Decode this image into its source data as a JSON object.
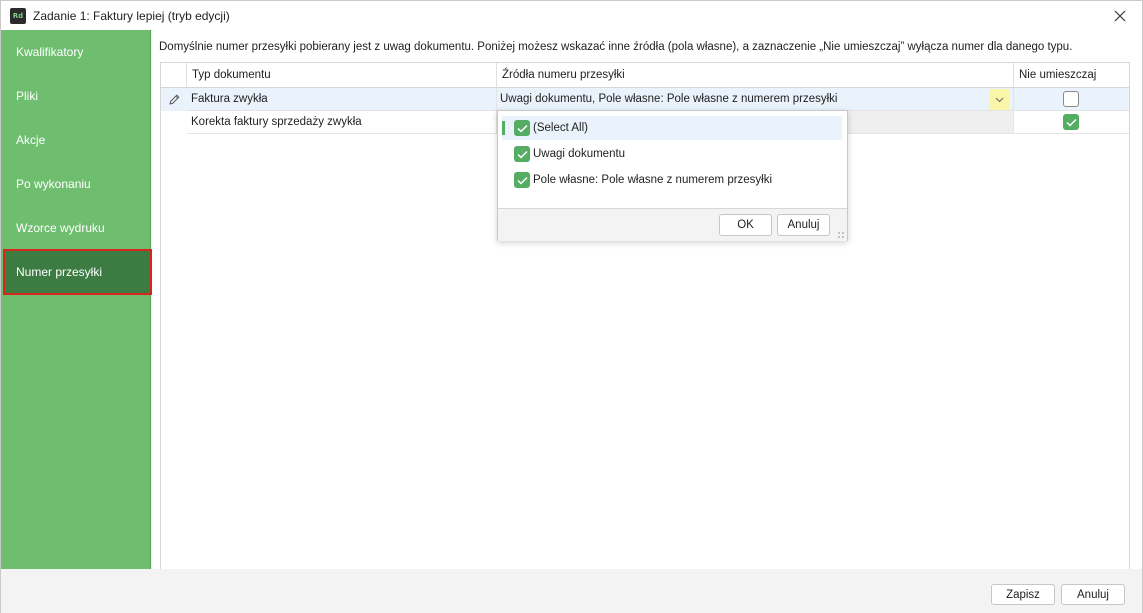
{
  "window": {
    "app_icon_text": "Rd",
    "title": "Zadanie 1: Faktury lepiej (tryb edycji)"
  },
  "sidebar": {
    "items": [
      {
        "label": "Kwalifikatory"
      },
      {
        "label": "Pliki"
      },
      {
        "label": "Akcje"
      },
      {
        "label": "Po wykonaniu"
      },
      {
        "label": "Wzorce wydruku"
      },
      {
        "label": "Numer przesyłki",
        "active": true
      }
    ]
  },
  "main": {
    "hint": "Domyślnie numer przesyłki pobierany jest z uwag dokumentu. Poniżej możesz wskazać inne źródła (pola własne), a zaznaczenie „Nie umieszczaj” wyłącza numer dla danego typu.",
    "grid": {
      "columns": [
        "Typ dokumentu",
        "Źródła numeru przesyłki",
        "Nie umieszczaj"
      ],
      "rows": [
        {
          "typ": "Faktura zwykła",
          "zrodla": "Uwagi dokumentu, Pole własne: Pole własne z numerem przesyłki",
          "nie_umieszczaj": false,
          "editing": true
        },
        {
          "typ": "Korekta faktury sprzedaży zwykła",
          "zrodla": "",
          "nie_umieszczaj": true,
          "editing": false
        }
      ]
    }
  },
  "dropdown": {
    "items": [
      {
        "label": "(Select All)",
        "checked": true,
        "focused": true
      },
      {
        "label": "Uwagi dokumentu",
        "checked": true
      },
      {
        "label": "Pole własne: Pole własne z numerem przesyłki",
        "checked": true
      }
    ],
    "ok_label": "OK",
    "cancel_label": "Anuluj"
  },
  "footer": {
    "save_label": "Zapisz",
    "cancel_label": "Anuluj"
  },
  "colors": {
    "sidebar_bg": "#6fbe70",
    "sidebar_active": "#3c7c43",
    "highlight_outline": "#d9261c",
    "checkbox_on": "#55ac63",
    "selected_row": "#eaf3fb",
    "combo_button": "#fbf5a9"
  }
}
